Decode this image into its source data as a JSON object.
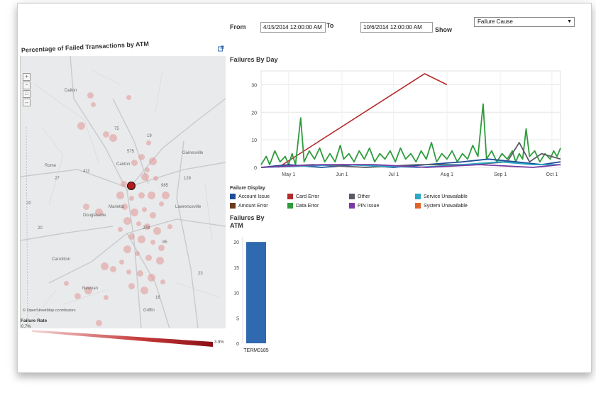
{
  "filters": {
    "from_label": "From",
    "from_value": "4/15/2014 12:00:00 AM",
    "to_label": "To",
    "to_value": "10/6/2014 12:00:00 AM",
    "show_label": "Show",
    "show_value": "Failure Cause"
  },
  "map": {
    "title": "Percentage of Failed Transactions by ATM",
    "cities": [
      "Dalton",
      "Rome",
      "Canton",
      "Gainesville",
      "Lawrenceville",
      "Marietta",
      "Douglasville",
      "Carrollton",
      "Newnan",
      "Griffin"
    ],
    "road_numbers": [
      "411",
      "75",
      "575",
      "985",
      "20",
      "85",
      "20",
      "278",
      "19",
      "16",
      "27",
      "129",
      "23"
    ],
    "attribution": "© OpenStreetMap contributors",
    "controls": [
      "+",
      "−",
      "□",
      "↔"
    ],
    "failure_rate_title": "Failure Rate",
    "failure_rate_min": "0.7%",
    "failure_rate_max": "3.9%",
    "colors": {
      "dot": "#e59a9a",
      "selected": "#b31b1b",
      "gradient_start": "#f4d7d7",
      "gradient_end": "#8a0f16"
    }
  },
  "external_link_icon": "external-link-icon",
  "failures_by_day": {
    "title": "Failures By Day",
    "legend_title": "Failure Display",
    "legend": [
      {
        "label": "Account Issue",
        "color": "#1f4e9c"
      },
      {
        "label": "Card Error",
        "color": "#b42a2a"
      },
      {
        "label": "Other",
        "color": "#5a5a66"
      },
      {
        "label": "Service Unavailable",
        "color": "#2aa8c4"
      },
      {
        "label": "Amount Error",
        "color": "#6b3a1e"
      },
      {
        "label": "Data Error",
        "color": "#2e9b3c"
      },
      {
        "label": "PIN Issue",
        "color": "#7a3aa6"
      },
      {
        "label": "System Unavailable",
        "color": "#e0642a"
      }
    ]
  },
  "failures_by_atm": {
    "title_line1": "Failures By",
    "title_line2": "ATM",
    "bar_label": "TERM0185"
  },
  "chart_data": [
    {
      "type": "line",
      "title": "Failures By Day",
      "x_ticks": [
        "May 1",
        "Jun 1",
        "Jul 1",
        "Aug 1",
        "Sep 1",
        "Oct 1"
      ],
      "x_domain": [
        "2014-04-15",
        "2014-10-06"
      ],
      "y_ticks": [
        0,
        10,
        20,
        30
      ],
      "ylim": [
        0,
        35
      ],
      "series": [
        {
          "name": "Card Error",
          "color": "#b42a2a",
          "points": [
            [
              "2014-04-25",
              0
            ],
            [
              "2014-07-19",
              34
            ],
            [
              "2014-08-01",
              30
            ]
          ]
        },
        {
          "name": "Data Error",
          "color": "#2e9b3c",
          "points": [
            [
              "2014-04-15",
              1
            ],
            [
              "2014-04-18",
              4
            ],
            [
              "2014-04-20",
              1
            ],
            [
              "2014-04-23",
              6
            ],
            [
              "2014-04-26",
              2
            ],
            [
              "2014-04-29",
              4
            ],
            [
              "2014-05-01",
              1
            ],
            [
              "2014-05-03",
              5
            ],
            [
              "2014-05-05",
              1
            ],
            [
              "2014-05-08",
              18
            ],
            [
              "2014-05-10",
              2
            ],
            [
              "2014-05-13",
              6
            ],
            [
              "2014-05-16",
              3
            ],
            [
              "2014-05-19",
              7
            ],
            [
              "2014-05-22",
              2
            ],
            [
              "2014-05-25",
              5
            ],
            [
              "2014-05-28",
              2
            ],
            [
              "2014-05-31",
              8
            ],
            [
              "2014-06-02",
              3
            ],
            [
              "2014-06-05",
              5
            ],
            [
              "2014-06-08",
              2
            ],
            [
              "2014-06-11",
              6
            ],
            [
              "2014-06-14",
              3
            ],
            [
              "2014-06-17",
              7
            ],
            [
              "2014-06-20",
              2
            ],
            [
              "2014-06-23",
              5
            ],
            [
              "2014-06-26",
              3
            ],
            [
              "2014-06-29",
              6
            ],
            [
              "2014-07-02",
              2
            ],
            [
              "2014-07-05",
              7
            ],
            [
              "2014-07-08",
              3
            ],
            [
              "2014-07-11",
              5
            ],
            [
              "2014-07-14",
              2
            ],
            [
              "2014-07-17",
              6
            ],
            [
              "2014-07-20",
              3
            ],
            [
              "2014-07-23",
              9
            ],
            [
              "2014-07-26",
              2
            ],
            [
              "2014-07-29",
              5
            ],
            [
              "2014-08-01",
              3
            ],
            [
              "2014-08-04",
              6
            ],
            [
              "2014-08-07",
              2
            ],
            [
              "2014-08-10",
              5
            ],
            [
              "2014-08-13",
              3
            ],
            [
              "2014-08-16",
              8
            ],
            [
              "2014-08-19",
              4
            ],
            [
              "2014-08-22",
              23
            ],
            [
              "2014-08-24",
              3
            ],
            [
              "2014-08-27",
              6
            ],
            [
              "2014-08-30",
              2
            ],
            [
              "2014-09-02",
              5
            ],
            [
              "2014-09-05",
              3
            ],
            [
              "2014-09-08",
              6
            ],
            [
              "2014-09-10",
              2
            ],
            [
              "2014-09-12",
              5
            ],
            [
              "2014-09-14",
              3
            ],
            [
              "2014-09-16",
              14
            ],
            [
              "2014-09-18",
              4
            ],
            [
              "2014-09-21",
              6
            ],
            [
              "2014-09-24",
              2
            ],
            [
              "2014-09-27",
              5
            ],
            [
              "2014-09-30",
              3
            ],
            [
              "2014-10-02",
              6
            ],
            [
              "2014-10-04",
              4
            ],
            [
              "2014-10-06",
              7
            ]
          ]
        },
        {
          "name": "Account Issue",
          "color": "#1f4e9c",
          "points": [
            [
              "2014-04-15",
              0
            ],
            [
              "2014-05-01",
              1
            ],
            [
              "2014-05-20",
              0
            ],
            [
              "2014-06-10",
              1
            ],
            [
              "2014-07-01",
              0
            ],
            [
              "2014-07-20",
              1
            ],
            [
              "2014-08-10",
              2
            ],
            [
              "2014-08-25",
              3
            ],
            [
              "2014-09-10",
              2
            ],
            [
              "2014-09-25",
              1
            ],
            [
              "2014-10-06",
              2
            ]
          ]
        },
        {
          "name": "Other",
          "color": "#5a5a66",
          "points": [
            [
              "2014-04-15",
              0
            ],
            [
              "2014-05-15",
              1
            ],
            [
              "2014-06-15",
              0
            ],
            [
              "2014-07-15",
              1
            ],
            [
              "2014-08-15",
              1
            ],
            [
              "2014-09-05",
              2
            ],
            [
              "2014-09-12",
              9
            ],
            [
              "2014-09-18",
              2
            ],
            [
              "2014-09-25",
              5
            ],
            [
              "2014-10-06",
              3
            ]
          ]
        },
        {
          "name": "Service Unavailable",
          "color": "#2aa8c4",
          "points": [
            [
              "2014-04-15",
              0
            ],
            [
              "2014-06-01",
              1
            ],
            [
              "2014-07-15",
              0
            ],
            [
              "2014-08-10",
              1
            ],
            [
              "2014-09-01",
              2
            ],
            [
              "2014-09-20",
              1
            ],
            [
              "2014-10-06",
              1
            ]
          ]
        },
        {
          "name": "PIN Issue",
          "color": "#7a3aa6",
          "points": [
            [
              "2014-04-15",
              0
            ],
            [
              "2014-05-20",
              1
            ],
            [
              "2014-06-20",
              1
            ],
            [
              "2014-07-20",
              0
            ],
            [
              "2014-08-20",
              1
            ],
            [
              "2014-09-20",
              0
            ],
            [
              "2014-10-06",
              1
            ]
          ]
        }
      ]
    },
    {
      "type": "bar",
      "title": "Failures By ATM",
      "categories": [
        "TERM0185"
      ],
      "values": [
        20
      ],
      "y_ticks": [
        0,
        5,
        10,
        15,
        20
      ],
      "ylim": [
        0,
        21
      ],
      "color": "#2f6ab0"
    }
  ]
}
